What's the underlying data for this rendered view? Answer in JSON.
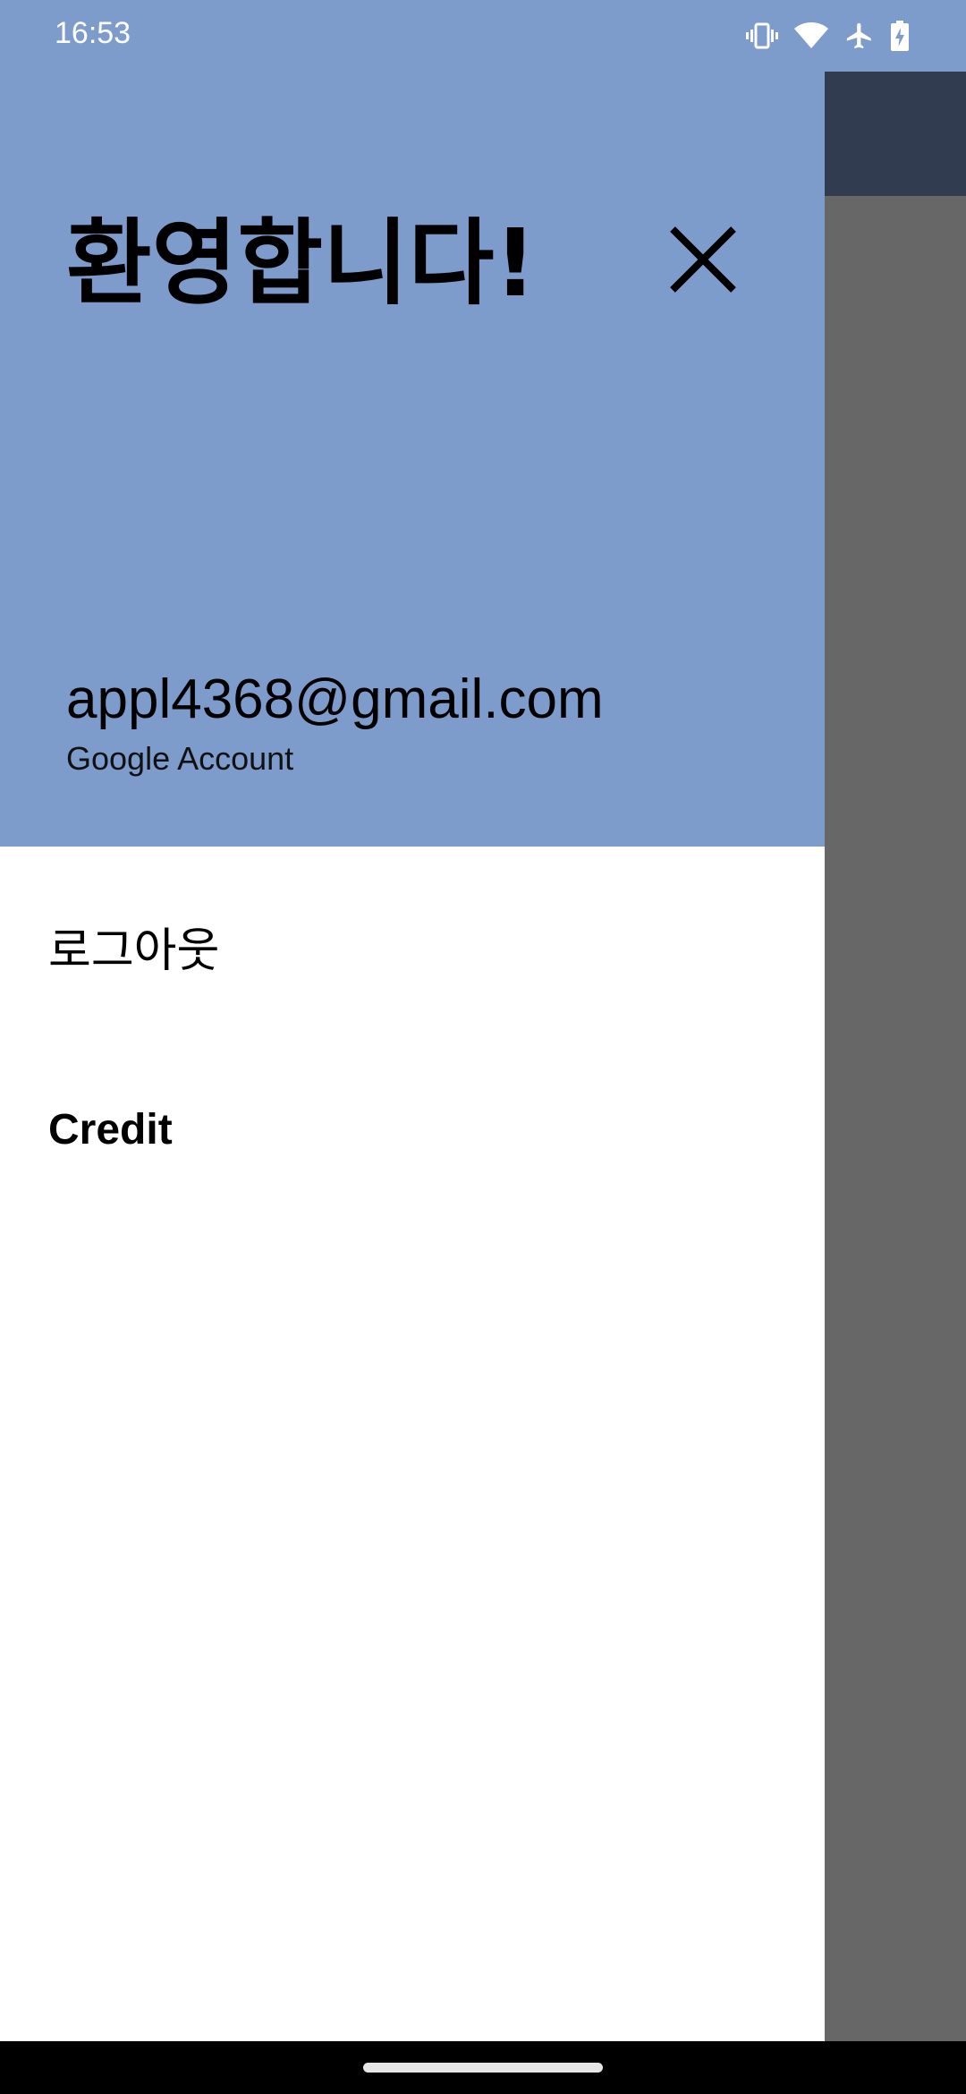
{
  "status_bar": {
    "time": "16:53",
    "icons": [
      "vibrate-icon",
      "wifi-icon",
      "airplane-icon",
      "battery-charging-icon"
    ]
  },
  "drawer": {
    "title": "환영합니다!",
    "close_icon": "close-icon",
    "account": {
      "email": "appl4368@gmail.com",
      "type": "Google Account"
    },
    "menu": [
      {
        "label": "로그아웃"
      },
      {
        "label": "Credit"
      }
    ]
  },
  "colors": {
    "header": "#7D9BCB",
    "app_toolbar": "#313C51",
    "scrim": "#676767",
    "drawer_bg": "#FFFFFF",
    "nav_bar": "#000000"
  }
}
